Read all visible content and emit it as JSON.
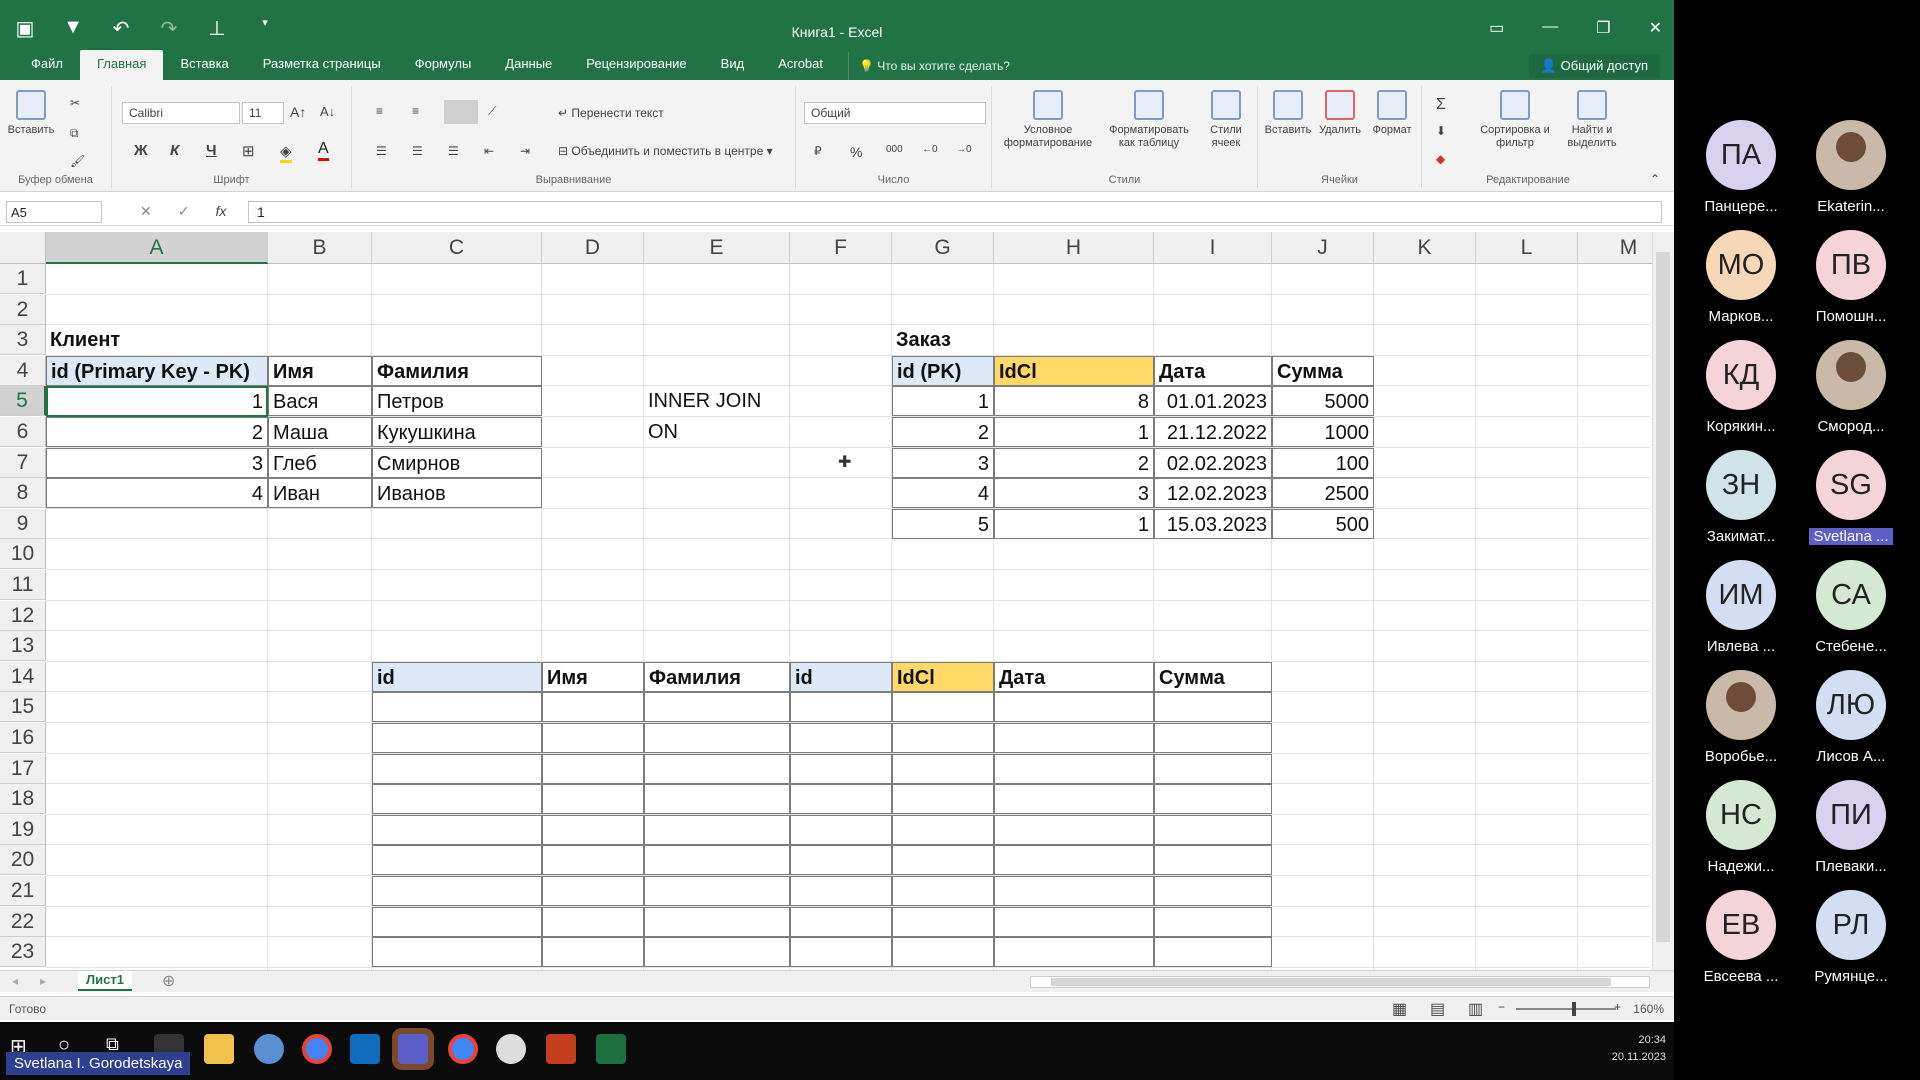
{
  "window": {
    "title": "Книга1 - Excel"
  },
  "ribbon_tabs": [
    "Файл",
    "Главная",
    "Вставка",
    "Разметка страницы",
    "Формулы",
    "Данные",
    "Рецензирование",
    "Вид",
    "Acrobat"
  ],
  "tell_me": "Что вы хотите сделать?",
  "share": "Общий доступ",
  "ribbon": {
    "clipboard": {
      "paste": "Вставить",
      "label": "Буфер обмена"
    },
    "font": {
      "name": "Calibri",
      "size": "11",
      "bold": "Ж",
      "italic": "К",
      "underline": "Ч",
      "label": "Шрифт"
    },
    "alignment": {
      "wrap": "Перенести текст",
      "merge": "Объединить и поместить в центре",
      "label": "Выравнивание"
    },
    "number": {
      "format": "Общий",
      "percent": "%",
      "label": "Число"
    },
    "styles": {
      "conditional": "Условное форматирование",
      "as_table": "Форматировать как таблицу",
      "cell_styles": "Стили ячеек",
      "label": "Стили"
    },
    "cells": {
      "insert": "Вставить",
      "delete": "Удалить",
      "format": "Формат",
      "label": "Ячейки"
    },
    "editing": {
      "sort": "Сортировка и фильтр",
      "find": "Найти и выделить",
      "label": "Редактирование"
    }
  },
  "formula_bar": {
    "name_box": "A5",
    "fx": "fx",
    "value": "1"
  },
  "columns": [
    "A",
    "B",
    "C",
    "D",
    "E",
    "F",
    "G",
    "H",
    "I",
    "J",
    "K",
    "L",
    "M"
  ],
  "rows": [
    "1",
    "2",
    "3",
    "4",
    "5",
    "6",
    "7",
    "8",
    "9",
    "10",
    "11",
    "12",
    "13",
    "14",
    "15",
    "16",
    "17",
    "18",
    "19",
    "20",
    "21",
    "22",
    "23"
  ],
  "client_table": {
    "title": "Клиент",
    "headers": [
      "id (Primary Key - PK)",
      "Имя",
      "Фамилия"
    ],
    "rows": [
      [
        "1",
        "Вася",
        "Петров"
      ],
      [
        "2",
        "Маша",
        "Кукушкина"
      ],
      [
        "3",
        "Глеб",
        "Смирнов"
      ],
      [
        "4",
        "Иван",
        "Иванов"
      ]
    ]
  },
  "join_text": {
    "inner_join": "INNER JOIN",
    "on": "ON"
  },
  "order_table": {
    "title": "Заказ",
    "headers": [
      "id (PK)",
      "IdCl",
      "Дата",
      "Сумма"
    ],
    "rows": [
      [
        "1",
        "8",
        "01.01.2023",
        "5000"
      ],
      [
        "2",
        "1",
        "21.12.2022",
        "1000"
      ],
      [
        "3",
        "2",
        "02.02.2023",
        "100"
      ],
      [
        "4",
        "3",
        "12.02.2023",
        "2500"
      ],
      [
        "5",
        "1",
        "15.03.2023",
        "500"
      ]
    ]
  },
  "result_table": {
    "headers": [
      "id",
      "Имя",
      "Фамилия",
      "id",
      "IdCl",
      "Дата",
      "Сумма"
    ]
  },
  "sheet_tab": "Лист1",
  "status": {
    "ready": "Готово",
    "zoom": "160%"
  },
  "taskbar": {
    "time": "20:34",
    "date": "20.11.2023"
  },
  "presenter": "Svetlana I. Gorodetskaya",
  "participants": [
    {
      "initials": "ПА",
      "name": "Панцере...",
      "color": "#d9d2ee"
    },
    {
      "initials": "",
      "name": "Ekaterin...",
      "color": "#c9b9a8"
    },
    {
      "initials": "МО",
      "name": "Марков...",
      "color": "#f6d8b8"
    },
    {
      "initials": "ПВ",
      "name": "Помошн...",
      "color": "#f4d4d8"
    },
    {
      "initials": "КД",
      "name": "Корякин...",
      "color": "#f4d4d8"
    },
    {
      "initials": "",
      "name": "Смород...",
      "color": "#c9b9a8"
    },
    {
      "initials": "ЗН",
      "name": "Закимат...",
      "color": "#cfe3e8"
    },
    {
      "initials": "SG",
      "name": "Svetlana ...",
      "color": "#f4d4d8"
    },
    {
      "initials": "ИМ",
      "name": "Ивлева ...",
      "color": "#d4def2"
    },
    {
      "initials": "СА",
      "name": "Стебене...",
      "color": "#d4e8d4"
    },
    {
      "initials": "",
      "name": "Воробье...",
      "color": "#c9b9a8"
    },
    {
      "initials": "ЛЮ",
      "name": "Лисов А...",
      "color": "#d4def2"
    },
    {
      "initials": "НС",
      "name": "Надежи...",
      "color": "#d4e8d4"
    },
    {
      "initials": "ПИ",
      "name": "Плеваки...",
      "color": "#d9d2ee"
    },
    {
      "initials": "ЕВ",
      "name": "Евсеева ...",
      "color": "#f4d4d8"
    },
    {
      "initials": "РЛ",
      "name": "Румянце...",
      "color": "#d4def2"
    }
  ]
}
